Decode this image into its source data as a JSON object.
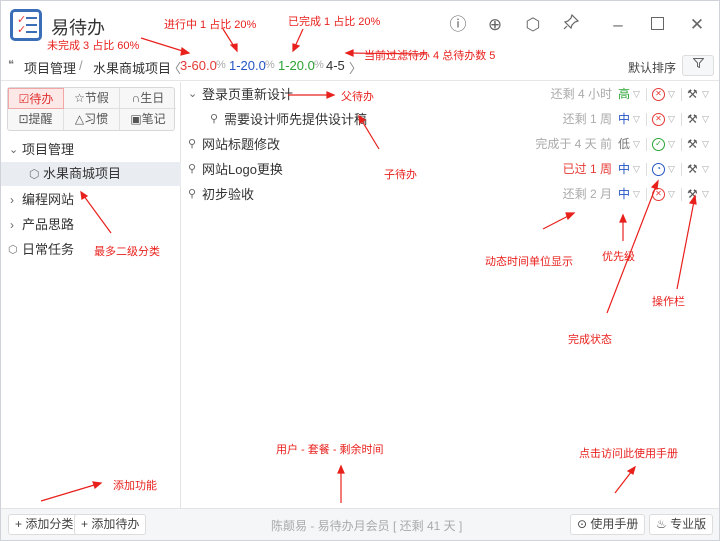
{
  "app": {
    "name": "易待办"
  },
  "toolbar": [
    "info-icon",
    "zoom-in-icon",
    "settings-icon",
    "pin-icon",
    "minimize-icon",
    "maximize-icon",
    "close-icon"
  ],
  "path": {
    "root": "项目管理",
    "slash": "/",
    "current": "水果商城项目",
    "lt": "〈",
    "gt": "〉",
    "uncompleted": "3-60.0",
    "inprogress": "1-20.0",
    "completed": "1-20.0",
    "pct": "%",
    "count": "4-5",
    "sort_label": "默认排序"
  },
  "tabs": [
    {
      "icon": "☑",
      "label": "待办",
      "active": true
    },
    {
      "icon": "☆",
      "label": "节假"
    },
    {
      "icon": "∩",
      "label": "生日"
    },
    {
      "icon": "⊡",
      "label": "提醒"
    },
    {
      "icon": "△",
      "label": "习惯"
    },
    {
      "icon": "▣",
      "label": "笔记"
    }
  ],
  "tree": [
    {
      "label": "项目管理",
      "expanded": true
    },
    {
      "label": "水果商城项目",
      "selected": true
    },
    {
      "label": "编程网站"
    },
    {
      "label": "产品思路"
    },
    {
      "label": "日常任务"
    }
  ],
  "todos": [
    {
      "title": "登录页重新设计",
      "remain": "还剩 4 小时",
      "priority": "高",
      "pcolor": "#2aa333",
      "status": "incomplete"
    },
    {
      "title": "需要设计师先提供设计稿",
      "remain": "还剩 1 周",
      "priority": "中",
      "pcolor": "#2455c4",
      "status": "incomplete"
    },
    {
      "title": "网站标题修改",
      "remain": "完成于 4 天 前",
      "priority": "低",
      "pcolor": "#777",
      "status": "done"
    },
    {
      "title": "网站Logo更换",
      "remain": "已过 1 周",
      "priority": "中",
      "pcolor": "#2455c4",
      "status": "in-progress",
      "overdue": true
    },
    {
      "title": "初步验收",
      "remain": "还剩 2 月",
      "priority": "中",
      "pcolor": "#2455c4",
      "status": "incomplete"
    }
  ],
  "footer": {
    "add_category": "+ 添加分类",
    "add_todo": "+ 添加待办",
    "member": "陈颠易 - 易待办月会员 [ 还剩 41 天 ]",
    "manual": "⊙ 使用手册",
    "pro": "♨ 专业版"
  },
  "annotations": {
    "uncompleted": "未完成 3 占比 60%",
    "inprogress": "进行中 1 占比 20%",
    "completed": "已完成 1 占比 20%",
    "filter": "当前过滤待办 4 总待办数 5",
    "parent": "父待办",
    "child": "子待办",
    "levels": "最多二级分类",
    "time": "动态时间单位显示",
    "priority": "优先级",
    "ops": "操作栏",
    "state": "完成状态",
    "user": "用户 - 套餐 - 剩余时间",
    "add": "添加功能",
    "manual": "点击访问此使用手册"
  }
}
